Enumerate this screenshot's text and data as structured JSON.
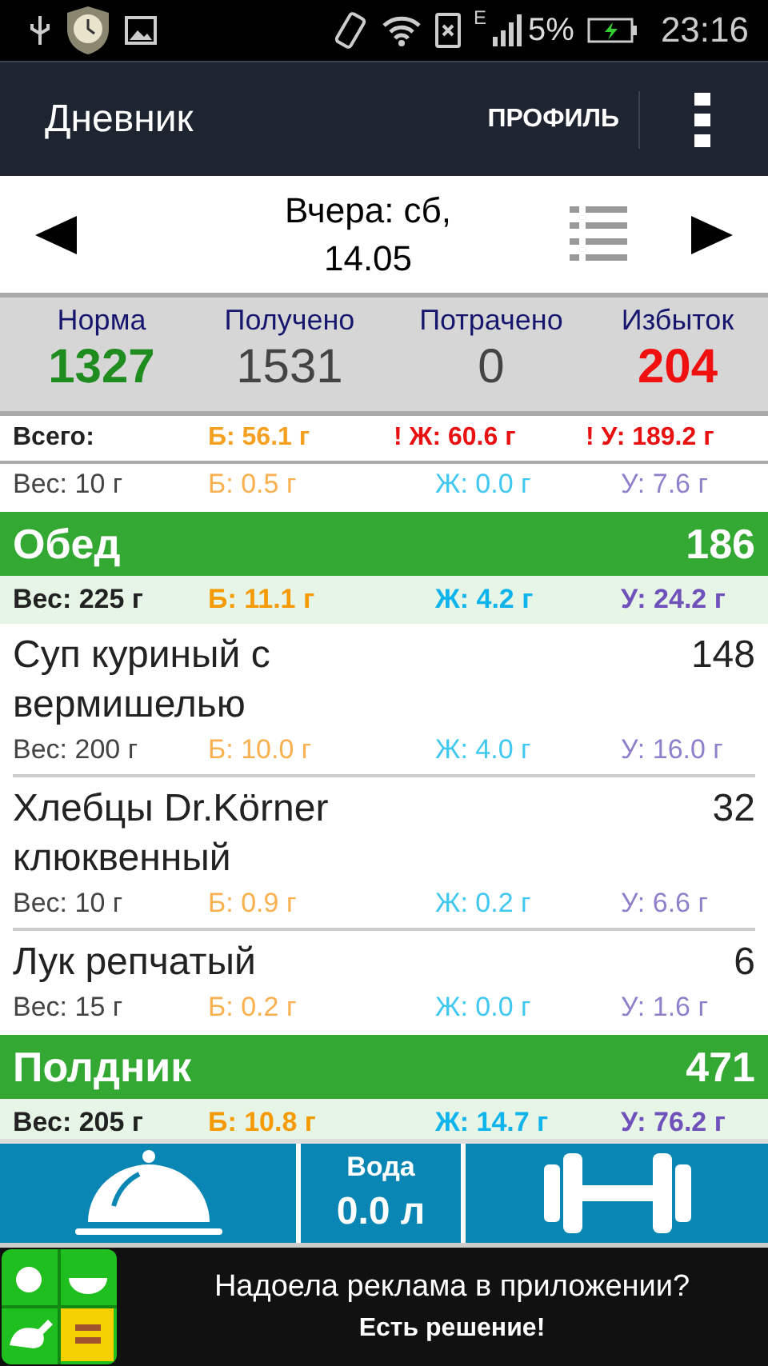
{
  "status_bar": {
    "network": "E",
    "battery": "5%",
    "time": "23:16"
  },
  "app_bar": {
    "title": "Дневник",
    "action": "ПРОФИЛЬ"
  },
  "date_nav": {
    "label": "Вчера: сб, 14.05"
  },
  "summary": [
    {
      "label": "Норма",
      "value": "1327",
      "color": "#1e8c1e"
    },
    {
      "label": "Получено",
      "value": "1531",
      "color": "#444444"
    },
    {
      "label": "Потрачено",
      "value": "0",
      "color": "#444444"
    },
    {
      "label": "Избыток",
      "value": "204",
      "color": "#f01010"
    }
  ],
  "totals": {
    "label": "Всего:",
    "items": [
      {
        "text": "Б: 56.1 г",
        "warning": false
      },
      {
        "text": "! Ж: 60.6 г",
        "warning": true
      },
      {
        "text": "! У: 189.2 г",
        "warning": true
      }
    ]
  },
  "rows": [
    {
      "kind": "tail",
      "macros": [
        "Вес: 10 г",
        "Б: 0.5 г",
        "Ж: 0.0 г",
        "У: 7.6 г"
      ]
    },
    {
      "kind": "meal",
      "name": "Обед",
      "calories": "186",
      "macros": [
        "Вес: 225 г",
        "Б: 11.1 г",
        "Ж: 4.2 г",
        "У: 24.2 г"
      ]
    },
    {
      "kind": "item",
      "name": "Суп куриный с вермишелью",
      "calories": "148",
      "macros": [
        "Вес: 200 г",
        "Б: 10.0 г",
        "Ж: 4.0 г",
        "У: 16.0 г"
      ]
    },
    {
      "kind": "item",
      "name": "Хлебцы Dr.Körner клюквенный",
      "calories": "32",
      "macros": [
        "Вес: 10 г",
        "Б: 0.9 г",
        "Ж: 0.2 г",
        "У: 6.6 г"
      ]
    },
    {
      "kind": "item",
      "name": "Лук репчатый",
      "calories": "6",
      "macros": [
        "Вес: 15 г",
        "Б: 0.2 г",
        "Ж: 0.0 г",
        "У: 1.6 г"
      ]
    },
    {
      "kind": "meal",
      "name": "Полдник",
      "calories": "471",
      "macros": [
        "Вес: 205 г",
        "Б: 10.8 г",
        "Ж: 14.7 г",
        "У: 76.2 г"
      ]
    }
  ],
  "water": {
    "label": "Вода",
    "value": "0.0 л"
  },
  "ad": {
    "title": "Надоела реклама в приложении?",
    "subtitle": "Есть решение!"
  }
}
